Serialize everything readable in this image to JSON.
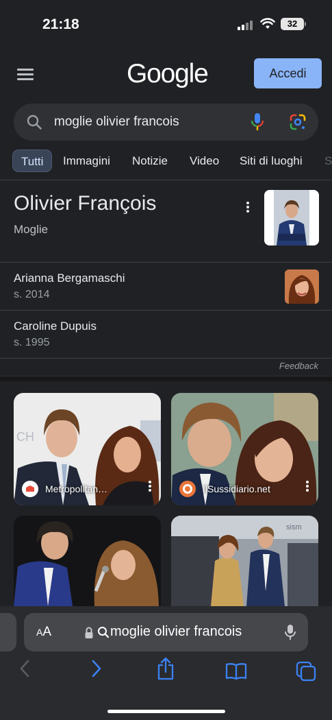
{
  "status_bar": {
    "time": "21:18",
    "battery": "32"
  },
  "header": {
    "logo": "Google",
    "signin_label": "Accedi"
  },
  "search": {
    "query": "moglie olivier francois"
  },
  "tabs": [
    {
      "label": "Tutti",
      "active": true
    },
    {
      "label": "Immagini"
    },
    {
      "label": "Notizie"
    },
    {
      "label": "Video"
    },
    {
      "label": "Siti di luoghi"
    }
  ],
  "knowledge_panel": {
    "title": "Olivier François",
    "subtitle": "Moglie",
    "entries": [
      {
        "name": "Arianna Bergamaschi",
        "detail": "s. 2014"
      },
      {
        "name": "Caroline Dupuis",
        "detail": "s. 1995"
      }
    ],
    "feedback": "Feedback"
  },
  "images": [
    {
      "source": "Metropolitan…"
    },
    {
      "source": "IlSussidiario.net"
    },
    {
      "source": ""
    },
    {
      "source": ""
    }
  ],
  "browser": {
    "text_size": "AA",
    "url": "moglie olivier francois"
  },
  "colors": {
    "accent": "#8ab4f8",
    "background": "#202124",
    "surface": "#303134"
  }
}
